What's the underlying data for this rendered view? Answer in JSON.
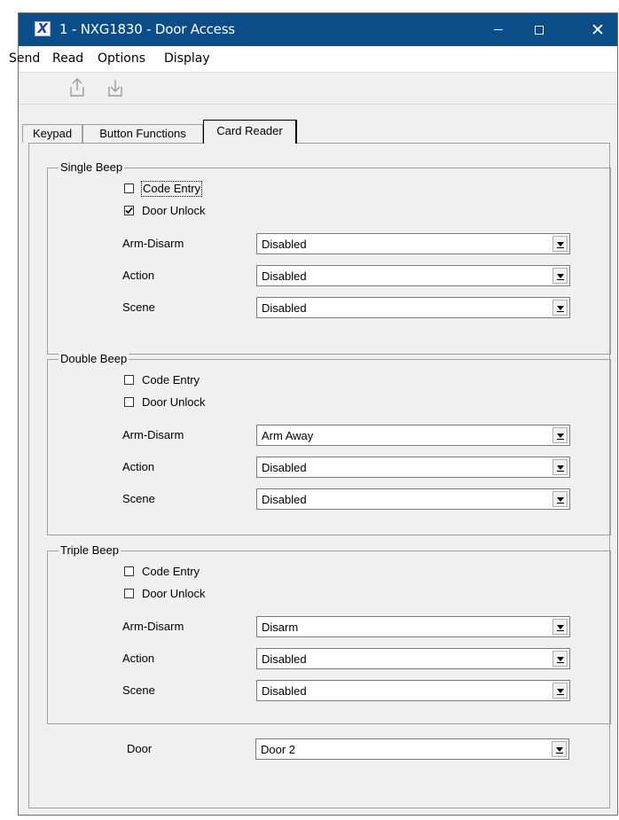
{
  "window": {
    "title": "1 - NXG1830 - Door Access",
    "app_icon": "X",
    "controls": {
      "minimize": "—",
      "maximize": "☐",
      "close": "✕"
    }
  },
  "menu": [
    "Send",
    "Read",
    "Options",
    "Display"
  ],
  "toolbar": {
    "icons": [
      "upload-icon",
      "download-icon"
    ]
  },
  "tabs": [
    {
      "label": "Keypad",
      "active": false
    },
    {
      "label": "Button Functions",
      "active": false
    },
    {
      "label": "Card Reader",
      "active": true
    }
  ],
  "groups": [
    {
      "title": "Single Beep",
      "checkboxes": [
        {
          "label": "Code Entry",
          "checked": false
        },
        {
          "label": "Door Unlock",
          "checked": true
        }
      ],
      "fields": [
        {
          "label": "Arm-Disarm",
          "value": "Disabled"
        },
        {
          "label": "Action",
          "value": "Disabled"
        },
        {
          "label": "Scene",
          "value": "Disabled"
        }
      ]
    },
    {
      "title": "Double Beep",
      "checkboxes": [
        {
          "label": "Code Entry",
          "checked": false
        },
        {
          "label": "Door Unlock",
          "checked": false
        }
      ],
      "fields": [
        {
          "label": "Arm-Disarm",
          "value": "Arm Away"
        },
        {
          "label": "Action",
          "value": "Disabled"
        },
        {
          "label": "Scene",
          "value": "Disabled"
        }
      ]
    },
    {
      "title": "Triple Beep",
      "checkboxes": [
        {
          "label": "Code Entry",
          "checked": false
        },
        {
          "label": "Door Unlock",
          "checked": false
        }
      ],
      "fields": [
        {
          "label": "Arm-Disarm",
          "value": "Disarm"
        },
        {
          "label": "Action",
          "value": "Disabled"
        },
        {
          "label": "Scene",
          "value": "Disabled"
        }
      ]
    }
  ],
  "door": {
    "label": "Door",
    "value": "Door 2"
  },
  "colors": {
    "titlebar": "#0b4d88",
    "window_bg": "#f0f0f0",
    "border": "#a0a0a0"
  }
}
